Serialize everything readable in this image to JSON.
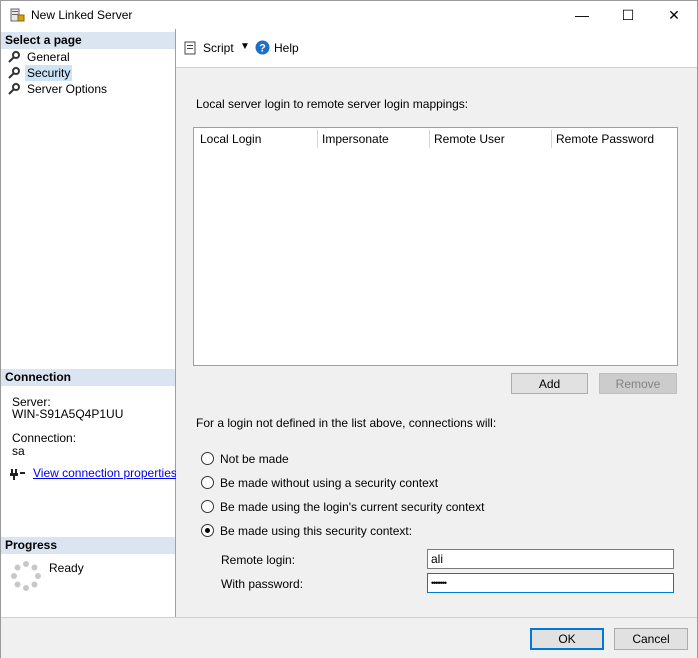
{
  "window": {
    "title": "New Linked Server",
    "minimize_glyph": "—",
    "maximize_glyph": "☐",
    "close_glyph": "✕"
  },
  "left_pane": {
    "select_page_header": "Select a page",
    "pages": [
      {
        "label": "General",
        "icon": "wrench-icon"
      },
      {
        "label": "Security",
        "icon": "wrench-icon",
        "selected": true
      },
      {
        "label": "Server Options",
        "icon": "wrench-icon"
      }
    ],
    "connection_header": "Connection",
    "server_label": "Server:",
    "server_value": "WIN-S91A5Q4P1UU",
    "connection_label": "Connection:",
    "connection_value": "sa",
    "view_connection_link": "View connection properties",
    "progress_header": "Progress",
    "progress_status": "Ready"
  },
  "toolbar": {
    "script_label": "Script",
    "help_label": "Help"
  },
  "security": {
    "mappings_label": "Local server login to remote server login mappings:",
    "columns": [
      "Local Login",
      "Impersonate",
      "Remote User",
      "Remote Password"
    ],
    "rows": [],
    "add_label": "Add",
    "remove_label": "Remove",
    "not_defined_label": "For a login not defined in the list above, connections will:",
    "options": [
      {
        "label": "Not be made",
        "selected": false
      },
      {
        "label": "Be made without using a security context",
        "selected": false
      },
      {
        "label": "Be made using the login's current security context",
        "selected": false
      },
      {
        "label": "Be made using this security context:",
        "selected": true
      }
    ],
    "remote_login_label": "Remote login:",
    "remote_login_value": "ali",
    "with_password_label": "With password:",
    "password_value": "•••••••"
  },
  "footer": {
    "ok_label": "OK",
    "cancel_label": "Cancel"
  },
  "colors": {
    "accent": "#0078d7",
    "header_bg": "#dbe5f2",
    "selected_bg": "#cce4f7",
    "link": "#0000ee"
  }
}
